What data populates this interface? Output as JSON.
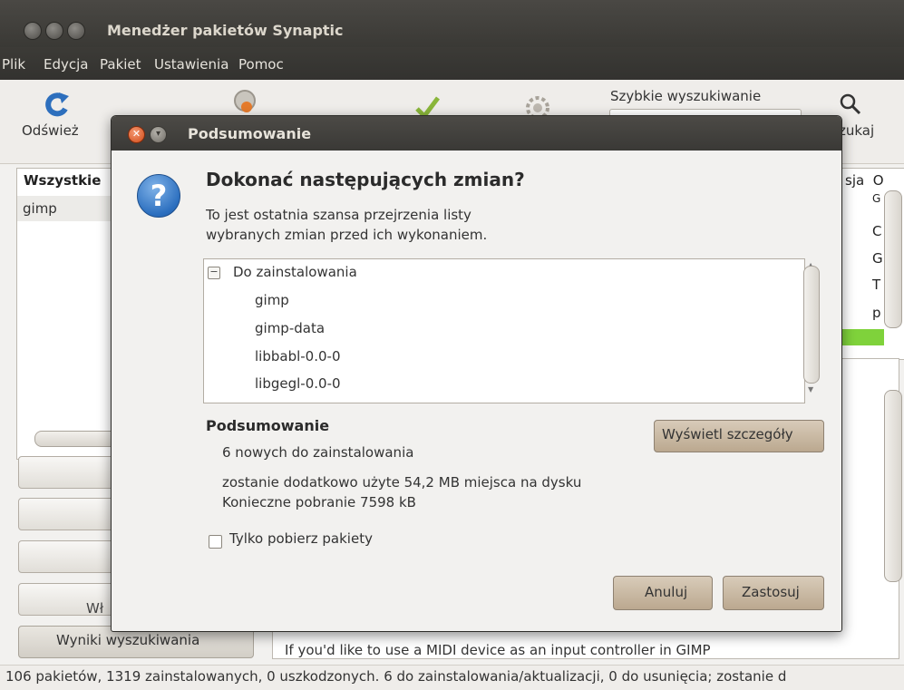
{
  "window": {
    "title": "Menedżer pakietów Synaptic",
    "menu": [
      "Plik",
      "Edycja",
      "Pakiet",
      "Ustawienia",
      "Pomoc"
    ]
  },
  "toolbar": {
    "refresh_label": "Odśwież",
    "search_label": "Szybkie wyszukiwanie",
    "find_label": "zukaj"
  },
  "background": {
    "left_header": "Wszystkie",
    "left_row": "gimp",
    "left_button": "Wł",
    "search_results_button": "Wyniki wyszukiwania",
    "right_header": "sja  O",
    "column_letters": [
      "G",
      "C",
      "G",
      "T",
      "p"
    ],
    "description_text": "If you'd like to use a MIDI device as an input controller in GIMP"
  },
  "status": {
    "text": "106 pakietów, 1319 zainstalowanych, 0 uszkodzonych. 6 do zainstalowania/aktualizacji, 0 do usunięcia; zostanie d"
  },
  "dialog": {
    "title": "Podsumowanie",
    "heading": "Dokonać następujących zmian?",
    "description_line1": "To jest ostatnia szansa przejrzenia listy",
    "description_line2": "wybranych zmian przed ich wykonaniem.",
    "group_label": "Do zainstalowania",
    "packages": [
      "gimp",
      "gimp-data",
      "libbabl-0.0-0",
      "libgegl-0.0-0"
    ],
    "summary_heading": "Podsumowanie",
    "summary_new": "6 nowych do zainstalowania",
    "summary_space": "zostanie dodatkowo użyte 54,2 MB miejsca na dysku",
    "summary_download": "Konieczne pobranie 7598 kB",
    "details_button": "Wyświetl szczegóły",
    "only_download_label": "Tylko pobierz pakiety",
    "only_download_checked": false,
    "cancel_button": "Anuluj",
    "apply_button": "Zastosuj"
  }
}
